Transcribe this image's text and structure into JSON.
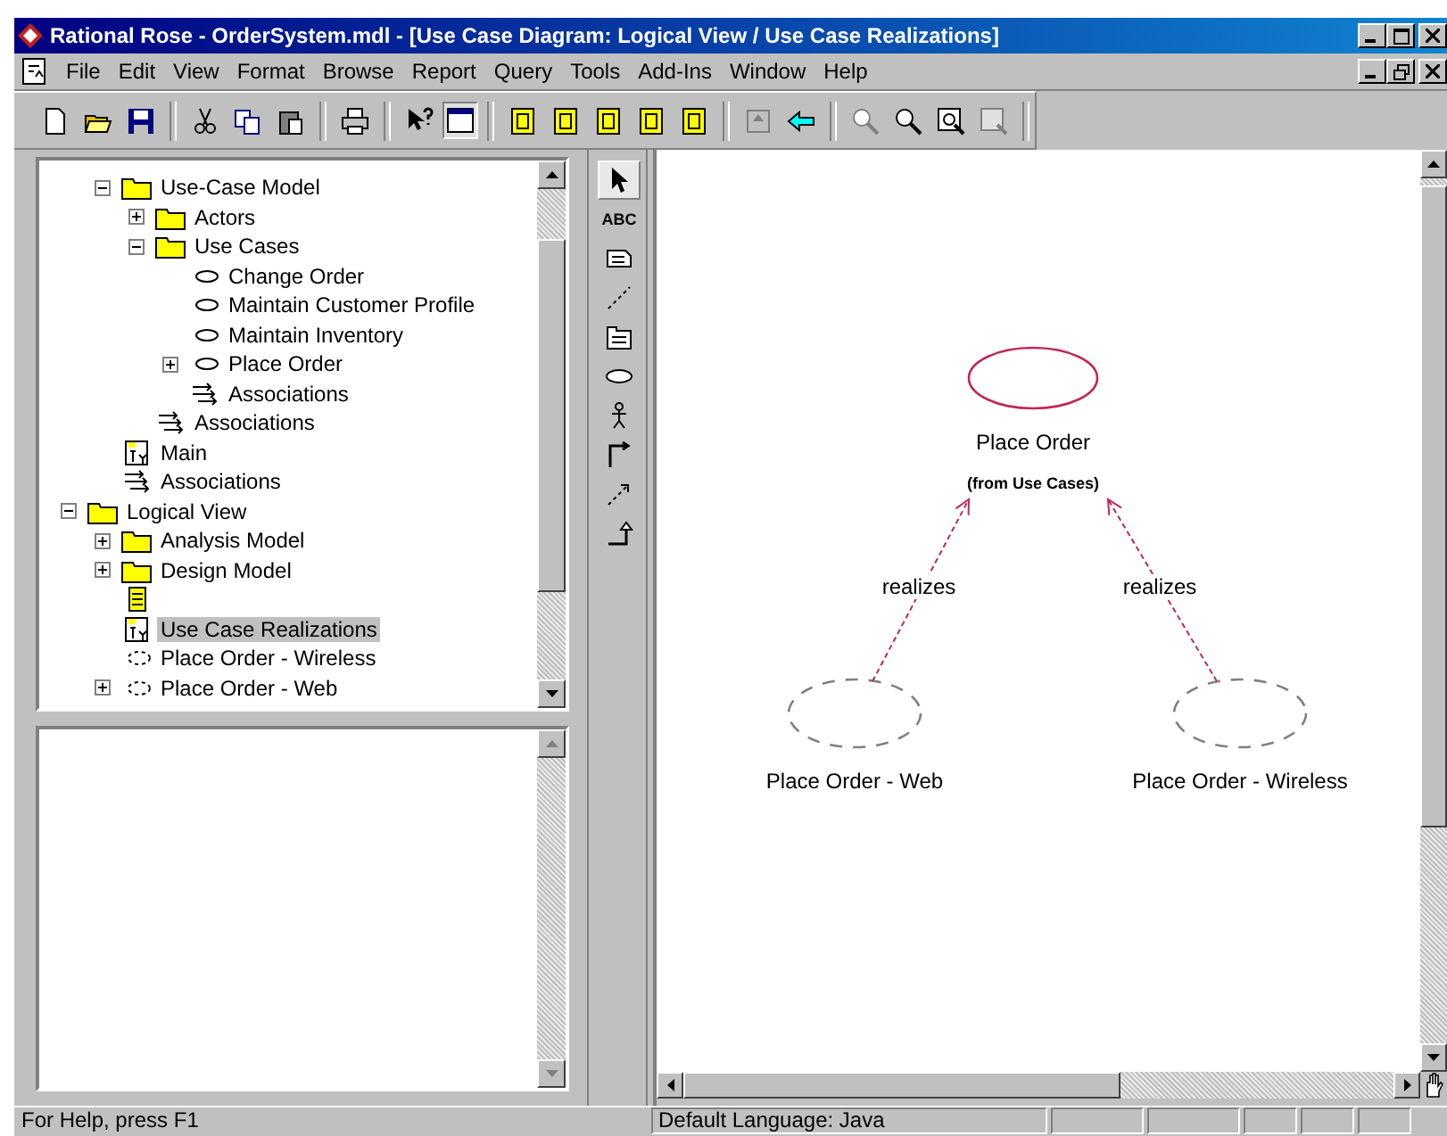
{
  "window": {
    "title": "Rational Rose - OrderSystem.mdl - [Use Case Diagram: Logical View / Use Case Realizations]"
  },
  "menu": [
    "File",
    "Edit",
    "View",
    "Format",
    "Browse",
    "Report",
    "Query",
    "Tools",
    "Add-Ins",
    "Window",
    "Help"
  ],
  "browser": {
    "tree": [
      {
        "kind": "folder",
        "label": "Use-Case Model",
        "expanded": true,
        "selected": false,
        "children": [
          {
            "kind": "folder",
            "label": "Actors",
            "expanded": false,
            "selected": false
          },
          {
            "kind": "folder",
            "label": "Use Cases",
            "expanded": true,
            "selected": false,
            "children": [
              {
                "kind": "usecase",
                "label": "Change Order",
                "selected": false
              },
              {
                "kind": "usecase",
                "label": "Maintain Customer Profile",
                "selected": false
              },
              {
                "kind": "usecase",
                "label": "Maintain Inventory",
                "selected": false
              },
              {
                "kind": "usecase",
                "label": "Place Order",
                "expanded": false,
                "selected": false
              },
              {
                "kind": "associations",
                "label": "Associations",
                "selected": false
              }
            ]
          },
          {
            "kind": "associations",
            "label": "Associations",
            "selected": false
          }
        ]
      },
      {
        "kind": "diagram",
        "label": "Main",
        "selected": false
      },
      {
        "kind": "associations",
        "label": "Associations",
        "selected": false
      }
    ],
    "tree2": [
      {
        "kind": "folder",
        "label": "Logical View",
        "expanded": true,
        "selected": false,
        "children": [
          {
            "kind": "folder",
            "label": "Analysis Model",
            "expanded": false,
            "selected": false
          },
          {
            "kind": "folder",
            "label": "Design Model",
            "expanded": false,
            "selected": false
          },
          {
            "kind": "classdiagram",
            "selected": false
          },
          {
            "kind": "diagram",
            "label": "Use Case Realizations",
            "selected": true
          },
          {
            "kind": "realization",
            "label": "Place Order - Wireless",
            "selected": false
          },
          {
            "kind": "realization",
            "label": "Place Order - Web",
            "expanded": false,
            "selected": false
          }
        ]
      }
    ]
  },
  "toolbox": [
    {
      "kind": "pointer",
      "selected": true
    },
    {
      "kind": "text",
      "label": "ABC",
      "selected": false
    },
    {
      "kind": "note",
      "selected": false
    },
    {
      "kind": "anchor",
      "selected": false
    },
    {
      "kind": "package",
      "selected": false
    },
    {
      "kind": "usecase",
      "selected": false
    },
    {
      "kind": "actor",
      "selected": false
    },
    {
      "kind": "association",
      "selected": false
    },
    {
      "kind": "dependency",
      "selected": false
    },
    {
      "kind": "generalization",
      "selected": false
    }
  ],
  "diagram": {
    "nodes": [
      {
        "kind": "usecase",
        "label": "Place Order",
        "sublabel": "(from Use Cases)"
      },
      {
        "kind": "realization",
        "label": "Place Order - Web"
      },
      {
        "kind": "realization",
        "label": "Place Order - Wireless"
      }
    ],
    "links": [
      {
        "label": "realizes"
      },
      {
        "label": "realizes"
      }
    ]
  },
  "status_bar": {
    "help": "For Help, press F1",
    "language": "Default Language: Java"
  }
}
